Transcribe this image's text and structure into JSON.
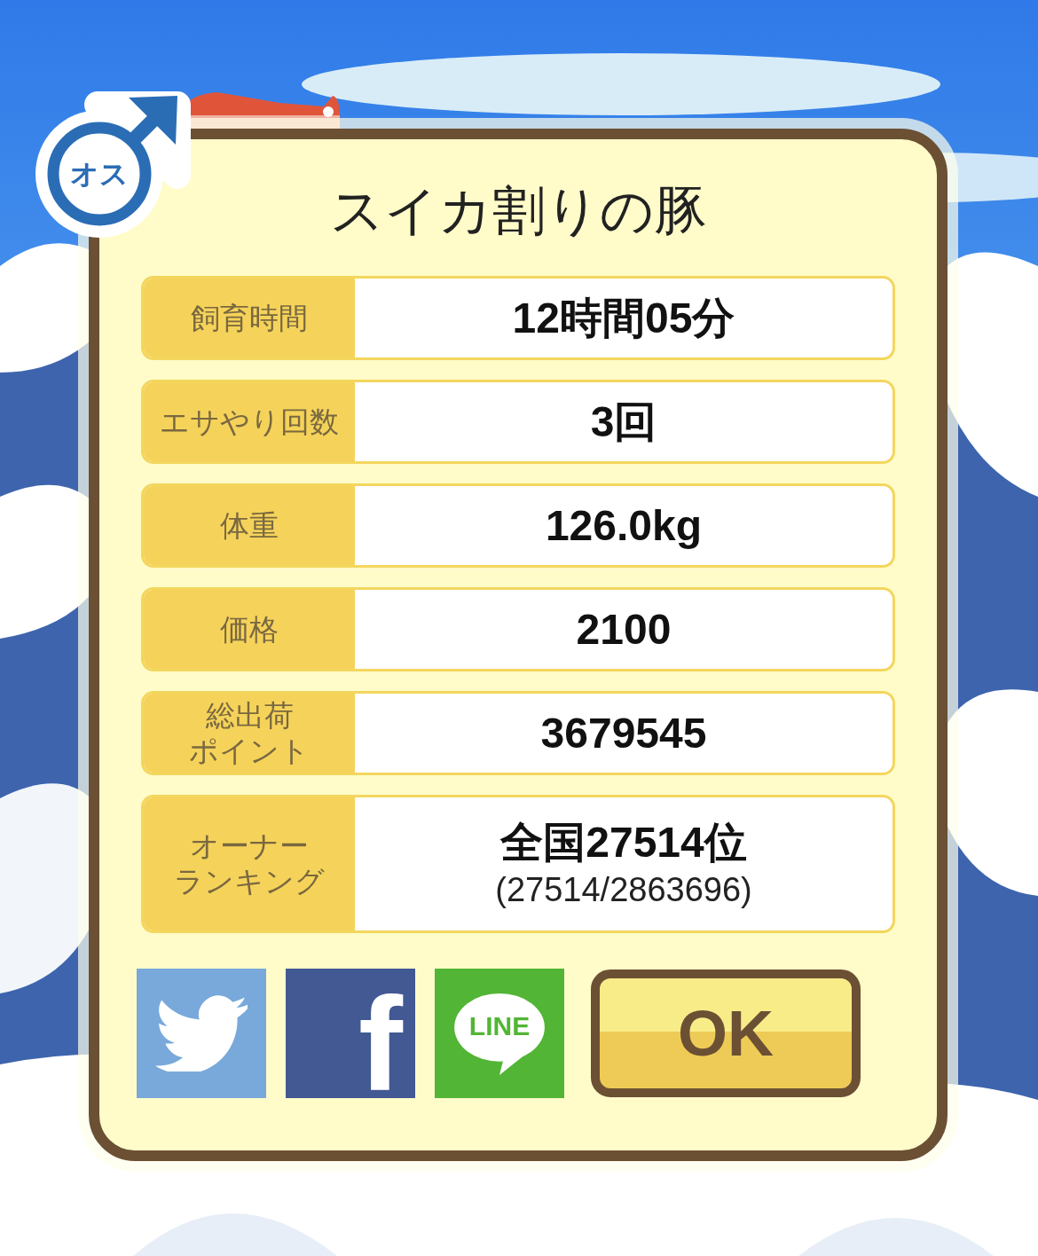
{
  "badge": {
    "label": "オス"
  },
  "title": "スイカ割りの豚",
  "stats": [
    {
      "label": [
        "飼育時間"
      ],
      "value": "12時間05分"
    },
    {
      "label": [
        "エサやり回数"
      ],
      "value": "3回"
    },
    {
      "label": [
        "体重"
      ],
      "value": "126.0kg"
    },
    {
      "label": [
        "価格"
      ],
      "value": "2100"
    },
    {
      "label": [
        "総出荷",
        "ポイント"
      ],
      "value": "3679545"
    },
    {
      "label": [
        "オーナー",
        "ランキング"
      ],
      "value": "全国27514位",
      "detail": "(27514/2863696)"
    }
  ],
  "share_buttons": [
    {
      "kind": "twitter"
    },
    {
      "kind": "facebook",
      "text": "f"
    },
    {
      "kind": "line",
      "text": "LINE"
    }
  ],
  "ok_button": "OK"
}
